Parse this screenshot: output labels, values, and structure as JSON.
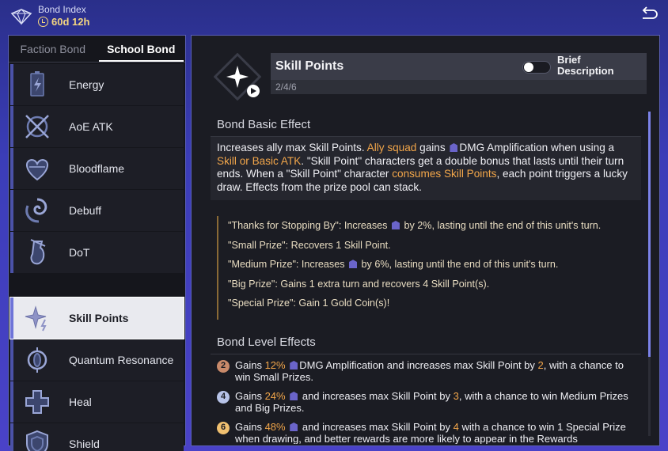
{
  "header": {
    "title": "Bond Index",
    "timer": "60d 12h"
  },
  "tabs": [
    {
      "label": "Faction Bond",
      "active": false
    },
    {
      "label": "School Bond",
      "active": true
    }
  ],
  "bonds": [
    {
      "label": "Energy",
      "icon": "battery-icon"
    },
    {
      "label": "AoE ATK",
      "icon": "aoe-atk-icon"
    },
    {
      "label": "Bloodflame",
      "icon": "heart-flame-icon"
    },
    {
      "label": "Debuff",
      "icon": "debuff-swirl-icon"
    },
    {
      "label": "DoT",
      "icon": "dot-flask-icon"
    },
    {
      "label": "Skill Points",
      "icon": "skill-points-icon",
      "selected": true
    },
    {
      "label": "Quantum Resonance",
      "icon": "quantum-icon"
    },
    {
      "label": "Heal",
      "icon": "heal-cross-icon"
    },
    {
      "label": "Shield",
      "icon": "shield-icon"
    }
  ],
  "detail": {
    "title": "Skill Points",
    "tiers": "2/4/6",
    "toggle_label_1": "Brief",
    "toggle_label_2": "Description",
    "toggle_on": false,
    "basic_title": "Bond Basic Effect",
    "basic": {
      "p1": "Increases ally max Skill Points. ",
      "h1": "Ally squad",
      "p2": " gains ",
      "p3": "DMG Amplification when using a ",
      "h2": "Skill or Basic ATK",
      "p4": ". \"Skill Point\" characters get a double bonus that lasts until their turn ends. When a \"Skill Point\" character ",
      "h3": "consumes Skill Points",
      "p5": ", each point triggers a lucky draw. Effects from the prize pool can stack."
    },
    "prizes": {
      "p1a": "\"Thanks for Stopping By\": Increases ",
      "p1b": " by 2%, lasting until the end of this unit's turn.",
      "p2": "\"Small Prize\": Recovers 1 Skill Point.",
      "p3a": "\"Medium Prize\": Increases ",
      "p3b": " by 6%, lasting until the end of this unit's turn.",
      "p4": "\"Big Prize\": Gains 1 extra turn and recovers 4 Skill Point(s).",
      "p5": "\"Special Prize\": Gain 1 Gold Coin(s)!"
    },
    "level_title": "Bond Level Effects",
    "levels": [
      {
        "badge": "2",
        "color": "#c98a6a",
        "a": "Gains ",
        "v1": "12%",
        "b": "DMG Amplification and increases max Skill Point by ",
        "v2": "2",
        "c": ", with a chance to win Small Prizes."
      },
      {
        "badge": "4",
        "color": "#b7c3e8",
        "a": "Gains ",
        "v1": "24%",
        "b": " and increases max Skill Point by ",
        "v2": "3",
        "c": ", with a chance to win Medium Prizes and Big Prizes."
      },
      {
        "badge": "6",
        "color": "#f0c070",
        "a": "Gains ",
        "v1": "48%",
        "b": " and increases max Skill Point by ",
        "v2": "4",
        "c": " with a chance to win 1 Special Prize when drawing, and better rewards are more likely to appear in the Rewards"
      }
    ]
  },
  "colors": {
    "accent": "#f2a64a",
    "panel_border": "#5a5fb8",
    "background": "#3b3db8"
  }
}
